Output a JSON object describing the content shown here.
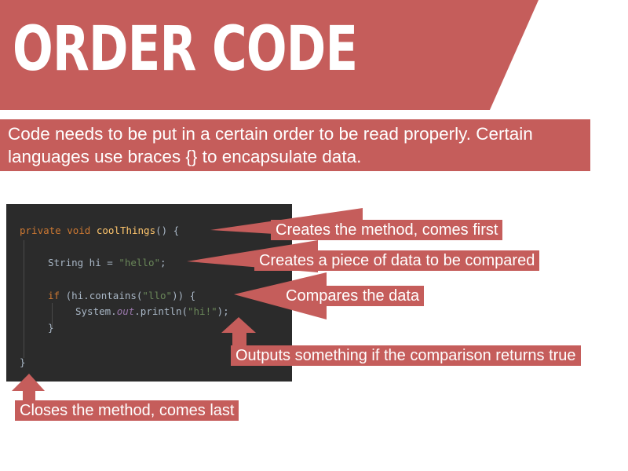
{
  "title": "ORDER CODE",
  "intro": "Code needs to be put in a certain order to be read properly. Certain languages use braces {} to encapsulate data.",
  "code": {
    "line1": {
      "kw": "private void",
      "fn": "coolThings",
      "rest": "() {"
    },
    "line2": {
      "pre": "String hi = ",
      "str": "\"hello\"",
      "post": ";"
    },
    "line3": {
      "kw": "if",
      "pre": " (hi.contains(",
      "str": "\"llo\"",
      "post": ")) {"
    },
    "line4": {
      "pre": "System.",
      "fld": "out",
      "mid": ".println(",
      "str": "\"hi!\"",
      "post": ");"
    },
    "line5": "}",
    "line6": "}"
  },
  "labels": {
    "method": "Creates the method, comes first",
    "data": "Creates a piece of data to be compared",
    "compare": "Compares the data",
    "output": "Outputs something if the comparison returns true",
    "close": "Closes the method, comes last"
  },
  "colors": {
    "accent": "#c55d5b",
    "code_bg": "#2b2b2b"
  }
}
